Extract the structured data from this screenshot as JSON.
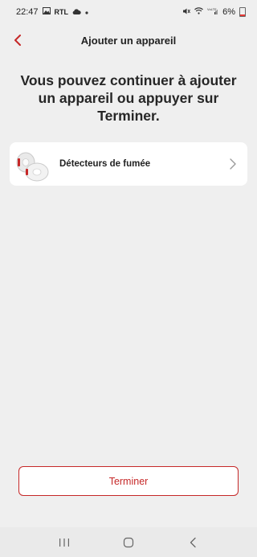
{
  "status_bar": {
    "time": "22:47",
    "left_icons": [
      "gallery-icon",
      "rtl-icon",
      "cloud-icon",
      "dot-icon"
    ],
    "rtl_text": "RTL",
    "battery_percent": "6%",
    "battery_level": 0.06
  },
  "header": {
    "title": "Ajouter un appareil"
  },
  "main": {
    "heading": "Vous pouvez continuer à ajouter un appareil ou appuyer sur Terminer."
  },
  "device_list": [
    {
      "label": "Détecteurs de fumée",
      "icon": "smoke-detector-icon"
    }
  ],
  "footer": {
    "finish_label": "Terminer"
  },
  "colors": {
    "accent": "#c62828",
    "background": "#efefef",
    "card": "#ffffff"
  }
}
